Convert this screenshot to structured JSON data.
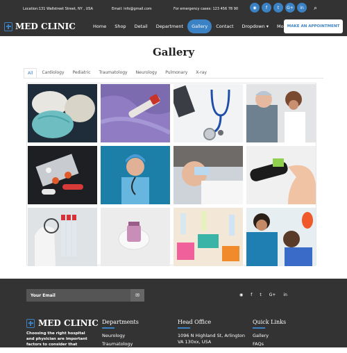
{
  "topbar": {
    "location": "Location:131 Wallstreet Street, NY , USA",
    "email": "Email: info@gmail.com",
    "emergency": "For emergency cases: 123 456 78 90",
    "social": [
      "rss",
      "f",
      "t",
      "G+",
      "in"
    ],
    "search_icon": "search-icon"
  },
  "brand": {
    "name": "MED CLINIC"
  },
  "nav": {
    "items": [
      "Home",
      "Shop",
      "Detail",
      "Department",
      "Gallery",
      "Contact",
      "Dropdown",
      "More"
    ],
    "active": "Gallery",
    "cta": "MAKE AN APPOINTMENT"
  },
  "page": {
    "title": "Gallery"
  },
  "filters": [
    "All",
    "Cardiology",
    "Pediatric",
    "Traumatology",
    "Neurology",
    "Pulmonary",
    "X-ray"
  ],
  "gallery": {
    "photos": [
      "masks",
      "blood-sample",
      "stethoscope",
      "surgeons",
      "pills",
      "nurse",
      "dentist-child",
      "glucose-meter",
      "lab-tubes",
      "pill-bottle",
      "lab-supplies",
      "dentist-patient"
    ]
  },
  "footer": {
    "email_placeholder": "Your Email",
    "social": [
      "rss",
      "f",
      "t",
      "G+",
      "in"
    ],
    "brand": "MED CLINIC",
    "desc": "Choosing the right hospital and physician are important factors to consider that significantly",
    "departments": {
      "heading": "Departments",
      "items": [
        "Neurology",
        "Traumatology"
      ]
    },
    "head_office": {
      "heading": "Head Office",
      "address": "1096 N Highland St, Arlington VA 130xx, USA"
    },
    "quick_links": {
      "heading": "Quick Links",
      "items": [
        "Gallery",
        "FAQs"
      ]
    }
  },
  "colors": {
    "accent": "#3b82c4",
    "dark": "#333333"
  }
}
